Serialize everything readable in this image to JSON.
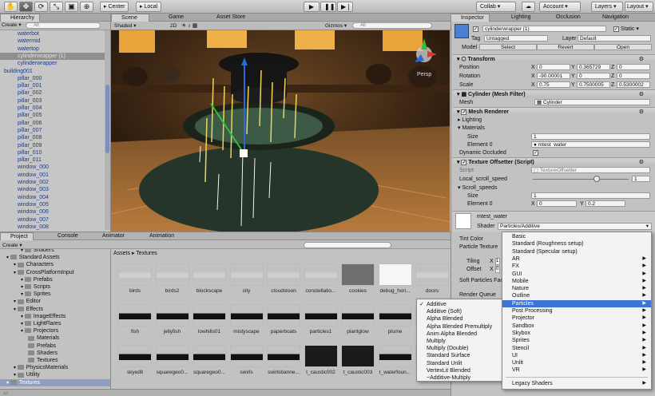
{
  "toolbar": {
    "tools": [
      "hand-icon",
      "move-icon",
      "rotate-icon",
      "scale-icon",
      "rect-icon",
      "transform-icon"
    ],
    "pivot": "Center",
    "space": "Local",
    "collab": "Collab",
    "account": "Account",
    "layers": "Layers",
    "layout": "Layout"
  },
  "hierarchy": {
    "tab": "Hierarchy",
    "create": "Create",
    "search_placeholder": "All",
    "items": [
      "waterbot",
      "watermid",
      "watertop",
      "cylinderwrapper (1)",
      "cylinderwrapper",
      "building001",
      "pillar_000",
      "pillar_001",
      "pillar_002",
      "pillar_003",
      "pillar_004",
      "pillar_005",
      "pillar_006",
      "pillar_007",
      "pillar_008",
      "pillar_009",
      "pillar_010",
      "pillar_011",
      "window_000",
      "window_001",
      "window_002",
      "window_003",
      "window_004",
      "window_005",
      "window_006",
      "window_007",
      "window_008"
    ]
  },
  "scene": {
    "tabs": [
      "Scene",
      "Game",
      "Asset Store"
    ],
    "shading": "Shaded",
    "mode2d": "2D",
    "gizmos": "Gizmos",
    "search_placeholder": "All",
    "persp": "Persp"
  },
  "inspector": {
    "tabs": [
      "Inspector",
      "Lighting",
      "Occlusion",
      "Navigation"
    ],
    "object_name": "cylinderwrapper (1)",
    "static": "Static",
    "tag_label": "Tag",
    "tag": "Untagged",
    "layer_label": "Layer",
    "layer": "Default",
    "model_label": "Model",
    "model_buttons": [
      "Select",
      "Revert",
      "Open"
    ],
    "transform": {
      "title": "Transform",
      "rows": [
        {
          "label": "Position",
          "x": "0",
          "y": "0.365729",
          "z": "0"
        },
        {
          "label": "Rotation",
          "x": "-90.00001",
          "y": "0",
          "z": "0"
        },
        {
          "label": "Scale",
          "x": "0.75",
          "y": "0.7500005",
          "z": "0.5300002"
        }
      ]
    },
    "mesh_filter": {
      "title": "Cylinder (Mesh Filter)",
      "mesh_label": "Mesh",
      "mesh": "Cylinder"
    },
    "mesh_renderer": {
      "title": "Mesh Renderer",
      "lighting": "Lighting",
      "materials": "Materials",
      "size_label": "Size",
      "size": "1",
      "element_label": "Element 0",
      "element": "mtest_water",
      "dyn_label": "Dynamic Occluded"
    },
    "texture_offsetter": {
      "title": "Texture Offsetter (Script)",
      "script_label": "Script",
      "script": "TextureOffsetter",
      "local_label": "Local_scroll_speed",
      "local_value": "1",
      "scroll_label": "Scroll_speeds",
      "size_label": "Size",
      "size": "1",
      "element_label": "Element 0",
      "ex": "0",
      "ey": "0.2"
    },
    "material": {
      "name": "mtest_water",
      "shader_label": "Shader",
      "shader": "Particles/Additive",
      "props": [
        "Tint Color",
        "Particle Texture",
        "Tiling",
        "Offset",
        "Soft Particles Fac",
        "Render Queue"
      ],
      "x_labels": [
        "X",
        "X"
      ],
      "values": [
        "1",
        "0"
      ]
    }
  },
  "project": {
    "tabs": [
      "Project",
      "Console",
      "Animator",
      "Animation"
    ],
    "create": "Create",
    "breadcrumb": [
      "Assets",
      "Textures"
    ],
    "tree": [
      {
        "label": "Shaders",
        "indent": 2
      },
      {
        "label": "Standard Assets",
        "indent": 0
      },
      {
        "label": "Characters",
        "indent": 1
      },
      {
        "label": "CrossPlatformInput",
        "indent": 1
      },
      {
        "label": "Prefabs",
        "indent": 2
      },
      {
        "label": "Scripts",
        "indent": 2
      },
      {
        "label": "Sprites",
        "indent": 2
      },
      {
        "label": "Editor",
        "indent": 1
      },
      {
        "label": "Effects",
        "indent": 1
      },
      {
        "label": "ImageEffects",
        "indent": 2
      },
      {
        "label": "LightFlares",
        "indent": 2
      },
      {
        "label": "Projectors",
        "indent": 2
      },
      {
        "label": "Materials",
        "indent": 3
      },
      {
        "label": "Prefabs",
        "indent": 3
      },
      {
        "label": "Shaders",
        "indent": 3
      },
      {
        "label": "Textures",
        "indent": 3
      },
      {
        "label": "PhysicsMaterials",
        "indent": 1
      },
      {
        "label": "Utility",
        "indent": 1
      },
      {
        "label": "Textures",
        "indent": 0
      }
    ],
    "assets": [
      [
        "birds",
        "birds2",
        "blockscape",
        "city",
        "cloudstoon",
        "constellatio...",
        "cookies",
        "debug_hori...",
        "doors"
      ],
      [
        "fish",
        "jellyfish",
        "lowhills01",
        "mistyscape",
        "paperboats",
        "particles1",
        "plantglow",
        "plume",
        "sea"
      ],
      [
        "skyedit",
        "squaregeo0...",
        "squaregeo0...",
        "swirls",
        "swirlsbanne...",
        "t_caustic002",
        "t_caustic003",
        "t_waterfoun...",
        "textu"
      ]
    ]
  },
  "blend_menu": {
    "items": [
      "Additive",
      "Additive (Soft)",
      "Alpha Blended",
      "Alpha Blended Premultiply",
      "Anim Alpha Blended",
      "Multiply",
      "Multiply (Double)",
      "Standard Surface",
      "Standard Unlit",
      "VertexLit Blended",
      "~Additive-Multiply"
    ],
    "checked": 0
  },
  "shader_menu": {
    "items": [
      "Basic",
      "Standard (Roughness setup)",
      "Standard (Specular setup)",
      "AR",
      "FX",
      "GUI",
      "Mobile",
      "Nature",
      "Outline",
      "Particles",
      "Post Processing",
      "Projector",
      "Sandbox",
      "Skybox",
      "Sprites",
      "Stencil",
      "UI",
      "Unlit",
      "VR",
      "Legacy Shaders"
    ],
    "submenu": [
      false,
      false,
      false,
      true,
      true,
      true,
      true,
      true,
      true,
      true,
      true,
      true,
      true,
      true,
      true,
      true,
      true,
      true,
      true,
      true
    ],
    "highlighted": 9
  },
  "colors": {
    "accent": "#3b73d6",
    "hierarchy_text": "#1a3d91"
  }
}
